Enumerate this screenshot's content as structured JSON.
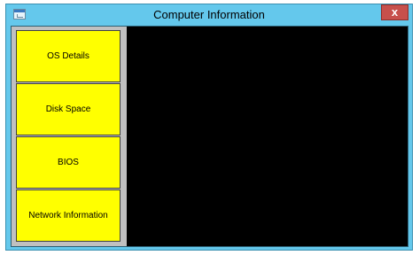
{
  "window": {
    "title": "Computer Information",
    "close_label": "x",
    "app_icon": "window-app-icon"
  },
  "sidebar": {
    "buttons": [
      {
        "label": "OS Details"
      },
      {
        "label": "Disk Space"
      },
      {
        "label": "BIOS"
      },
      {
        "label": "Network Information"
      }
    ]
  },
  "colors": {
    "title_bar": "#64c8ec",
    "close_button": "#c7504c",
    "button_fill": "#ffff00",
    "content_background": "#000000",
    "sidebar_background": "#c0c0c0"
  }
}
